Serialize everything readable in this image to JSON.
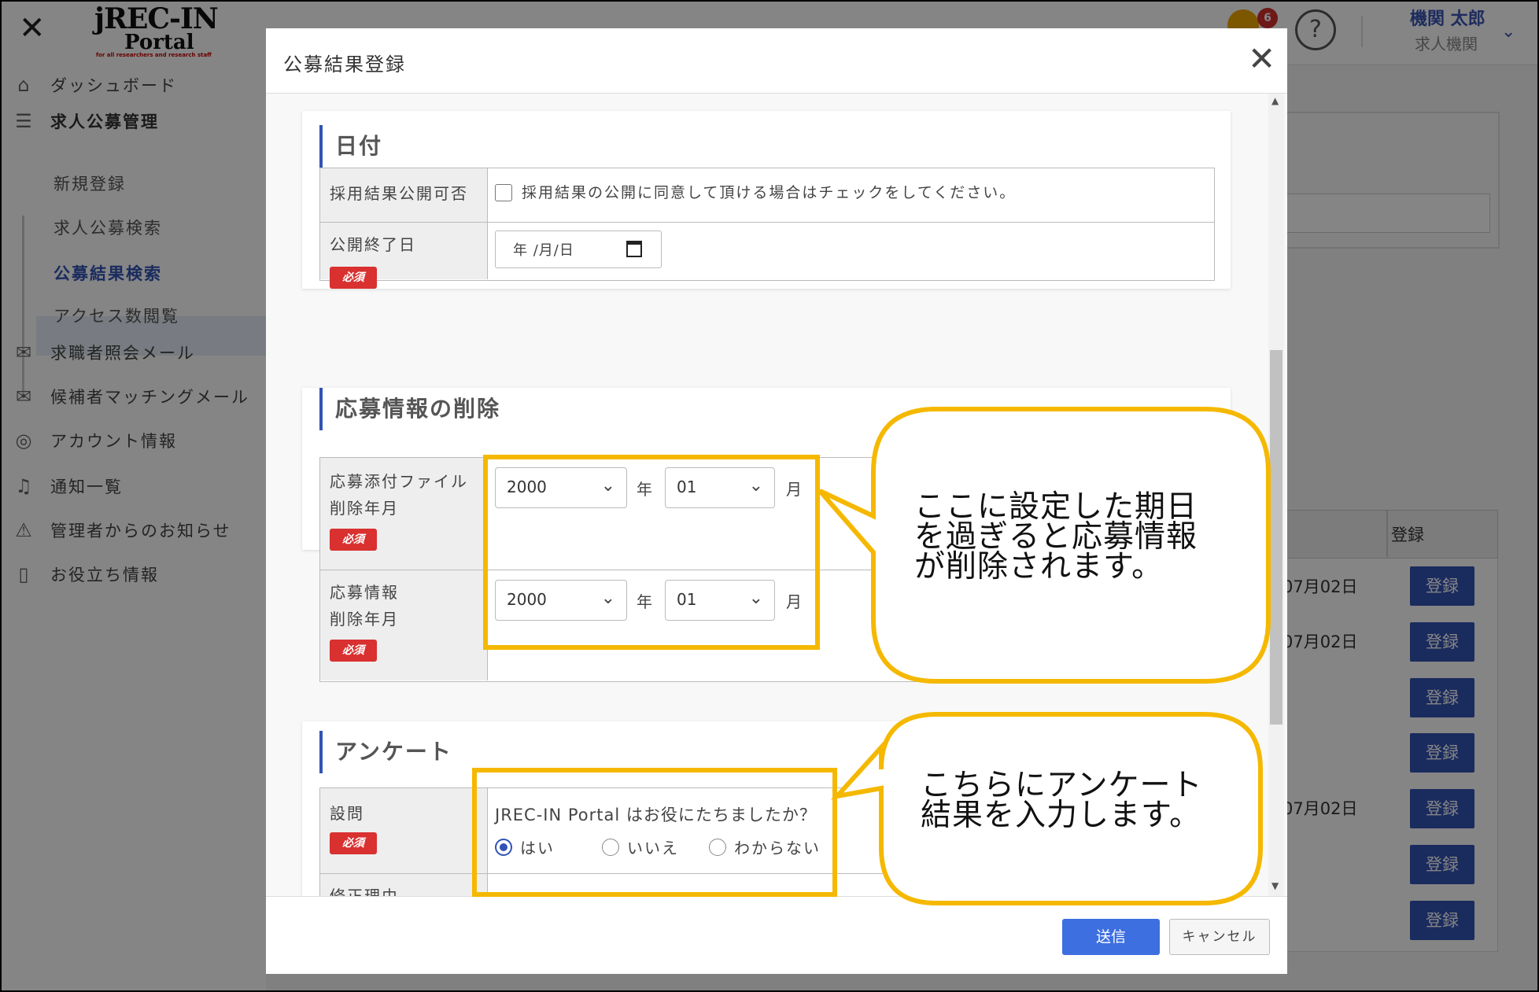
{
  "header": {
    "close_glyph": "✕",
    "logo_line1": "jREC-IN",
    "logo_line2": "Portal",
    "logo_tagline": "for all researchers and research staff",
    "notification_count": "6",
    "help_glyph": "?",
    "user_name": "機関 太郎",
    "user_org": "求人機関"
  },
  "sidebar": {
    "items": [
      {
        "label": "ダッシュボード",
        "icon": "home-icon"
      },
      {
        "label": "求人公募管理",
        "icon": "signpost-icon"
      },
      {
        "label": "求職者照会メール",
        "icon": "mail-icon"
      },
      {
        "label": "候補者マッチングメール",
        "icon": "mail-open-icon"
      },
      {
        "label": "アカウント情報",
        "icon": "user-circle-icon"
      },
      {
        "label": "通知一覧",
        "icon": "bell-icon"
      },
      {
        "label": "管理者からのお知らせ",
        "icon": "warning-icon"
      },
      {
        "label": "お役立ち情報",
        "icon": "book-icon"
      }
    ],
    "subitems": [
      "新規登録",
      "求人公募検索",
      "公募結果検索",
      "アクセス数閲覧"
    ],
    "active_subitem": "公募結果検索"
  },
  "background_table": {
    "header_label": "登録",
    "dates": [
      "07月02日",
      "07月02日",
      "07月02日"
    ],
    "button_label": "登録"
  },
  "modal": {
    "title": "公募結果登録",
    "sections": {
      "date": {
        "title": "日付",
        "publish_label": "採用結果公開可否",
        "publish_checkbox_text": "採用結果の公開に同意して頂ける場合はチェックをしてください。",
        "end_date_label": "公開終了日",
        "end_date_placeholder": "年 /月/日"
      },
      "deletion": {
        "title": "応募情報の削除",
        "attach_label_1": "応募添付ファイル",
        "attach_label_2": "削除年月",
        "info_label_1": "応募情報",
        "info_label_2": "削除年月",
        "year_value": "2000",
        "month_value": "01",
        "year_unit": "年",
        "month_unit": "月"
      },
      "survey": {
        "title": "アンケート",
        "question_label": "設問",
        "question_text": "JREC-IN Portal はお役にたちましたか？",
        "options": [
          "はい",
          "いいえ",
          "わからない"
        ],
        "selected": "はい",
        "next_label_partial": "修正理由"
      }
    },
    "required_badge": "必須",
    "send_button": "送信",
    "cancel_button": "キャンセル"
  },
  "annotations": {
    "callout1": [
      "ここに設定した期日",
      "を過ぎると応募情報",
      "が削除されます。"
    ],
    "callout2": [
      "こちらにアンケート",
      "結果を入力します。"
    ],
    "highlight_color": "#f5b800"
  }
}
